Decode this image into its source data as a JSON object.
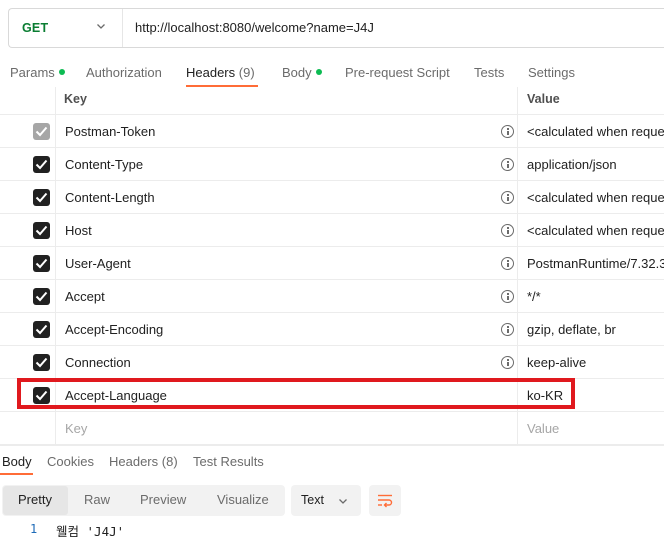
{
  "request": {
    "method": "GET",
    "url": "http://localhost:8080/welcome?name=J4J"
  },
  "request_tabs": [
    {
      "label": "Params",
      "has_dot": true
    },
    {
      "label": "Authorization"
    },
    {
      "label": "Headers",
      "count": "(9)",
      "active": true
    },
    {
      "label": "Body",
      "has_dot": true
    },
    {
      "label": "Pre-request Script"
    },
    {
      "label": "Tests"
    },
    {
      "label": "Settings"
    }
  ],
  "headers_table": {
    "columns": [
      "Key",
      "Value"
    ],
    "rows": [
      {
        "key": "Postman-Token",
        "value": "<calculated when reque",
        "checked": true,
        "disabled": true
      },
      {
        "key": "Content-Type",
        "value": "application/json",
        "checked": true
      },
      {
        "key": "Content-Length",
        "value": "<calculated when reque",
        "checked": true
      },
      {
        "key": "Host",
        "value": "<calculated when reque",
        "checked": true
      },
      {
        "key": "User-Agent",
        "value": "PostmanRuntime/7.32.3",
        "checked": true
      },
      {
        "key": "Accept",
        "value": "*/*",
        "checked": true
      },
      {
        "key": "Accept-Encoding",
        "value": "gzip, deflate, br",
        "checked": true
      },
      {
        "key": "Connection",
        "value": "keep-alive",
        "checked": true
      },
      {
        "key": "Accept-Language",
        "value": "ko-KR",
        "checked": true,
        "highlighted": true
      }
    ],
    "new_row": {
      "key_placeholder": "Key",
      "value_placeholder": "Value"
    }
  },
  "highlight_color": "#e0191e",
  "accent_color": "#ff6c37",
  "response_tabs": [
    {
      "label": "Body",
      "active": true
    },
    {
      "label": "Cookies"
    },
    {
      "label": "Headers",
      "count": "(8)"
    },
    {
      "label": "Test Results"
    }
  ],
  "format_options": [
    "Pretty",
    "Raw",
    "Preview",
    "Visualize"
  ],
  "format_selected": "Pretty",
  "language": "Text",
  "response_body": {
    "line_number": "1",
    "content": "웰컴 'J4J'"
  }
}
